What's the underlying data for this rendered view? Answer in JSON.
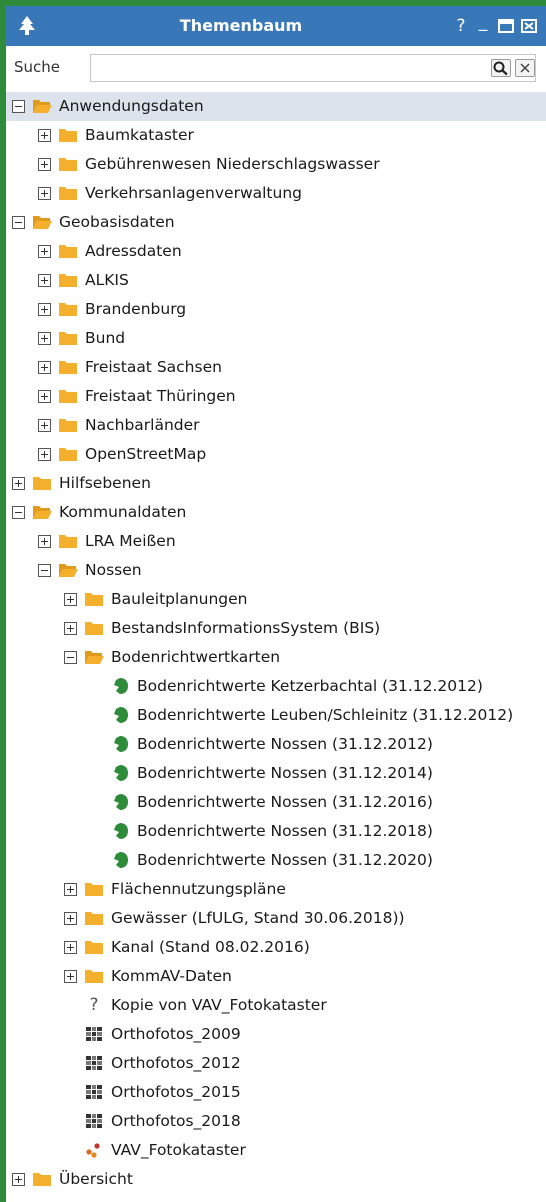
{
  "window": {
    "title": "Themenbaum",
    "icon": "tree-icon",
    "buttons": [
      {
        "name": "help-button",
        "glyph": "?"
      },
      {
        "name": "minimize-button",
        "glyph": "_"
      },
      {
        "name": "maximize-button",
        "glyph": "▭"
      },
      {
        "name": "close-button",
        "glyph": "✕"
      }
    ]
  },
  "search": {
    "label": "Suche",
    "value": "",
    "placeholder": ""
  },
  "colors": {
    "titlebar": "#3877b8",
    "folder": "#f4b02c",
    "layer_green": "#2e8b3a",
    "selected_row": "#dde3ed"
  },
  "tree": [
    {
      "label": "Anwendungsdaten",
      "level": 0,
      "expander": "minus",
      "icon": "folder-open-icon",
      "selected": true
    },
    {
      "label": "Baumkataster",
      "level": 1,
      "expander": "plus",
      "icon": "folder-icon"
    },
    {
      "label": "Gebührenwesen Niederschlagswasser",
      "level": 1,
      "expander": "plus",
      "icon": "folder-icon"
    },
    {
      "label": "Verkehrsanlagenverwaltung",
      "level": 1,
      "expander": "plus",
      "icon": "folder-icon"
    },
    {
      "label": "Geobasisdaten",
      "level": 0,
      "expander": "minus",
      "icon": "folder-open-icon"
    },
    {
      "label": "Adressdaten",
      "level": 1,
      "expander": "plus",
      "icon": "folder-icon"
    },
    {
      "label": "ALKIS",
      "level": 1,
      "expander": "plus",
      "icon": "folder-icon"
    },
    {
      "label": "Brandenburg",
      "level": 1,
      "expander": "plus",
      "icon": "folder-icon"
    },
    {
      "label": "Bund",
      "level": 1,
      "expander": "plus",
      "icon": "folder-icon"
    },
    {
      "label": "Freistaat Sachsen",
      "level": 1,
      "expander": "plus",
      "icon": "folder-icon"
    },
    {
      "label": "Freistaat Thüringen",
      "level": 1,
      "expander": "plus",
      "icon": "folder-icon"
    },
    {
      "label": "Nachbarländer",
      "level": 1,
      "expander": "plus",
      "icon": "folder-icon"
    },
    {
      "label": "OpenStreetMap",
      "level": 1,
      "expander": "plus",
      "icon": "folder-icon"
    },
    {
      "label": "Hilfsebenen",
      "level": 0,
      "expander": "plus",
      "icon": "folder-icon"
    },
    {
      "label": "Kommunaldaten",
      "level": 0,
      "expander": "minus",
      "icon": "folder-open-icon"
    },
    {
      "label": "LRA Meißen",
      "level": 1,
      "expander": "plus",
      "icon": "folder-icon"
    },
    {
      "label": "Nossen",
      "level": 1,
      "expander": "minus",
      "icon": "folder-open-icon"
    },
    {
      "label": "Bauleitplanungen",
      "level": 2,
      "expander": "plus",
      "icon": "folder-icon"
    },
    {
      "label": "BestandsInformationsSystem (BIS)",
      "level": 2,
      "expander": "plus",
      "icon": "folder-icon"
    },
    {
      "label": "Bodenrichtwertkarten",
      "level": 2,
      "expander": "minus",
      "icon": "folder-open-icon"
    },
    {
      "label": "Bodenrichtwerte Ketzerbachtal (31.12.2012)",
      "level": 3,
      "expander": "none",
      "icon": "layer-shape-icon"
    },
    {
      "label": "Bodenrichtwerte Leuben/Schleinitz (31.12.2012)",
      "level": 3,
      "expander": "none",
      "icon": "layer-shape-icon"
    },
    {
      "label": "Bodenrichtwerte Nossen (31.12.2012)",
      "level": 3,
      "expander": "none",
      "icon": "layer-shape-icon"
    },
    {
      "label": "Bodenrichtwerte Nossen (31.12.2014)",
      "level": 3,
      "expander": "none",
      "icon": "layer-shape-icon"
    },
    {
      "label": "Bodenrichtwerte Nossen (31.12.2016)",
      "level": 3,
      "expander": "none",
      "icon": "layer-shape-icon"
    },
    {
      "label": "Bodenrichtwerte Nossen (31.12.2018)",
      "level": 3,
      "expander": "none",
      "icon": "layer-shape-icon"
    },
    {
      "label": "Bodenrichtwerte Nossen (31.12.2020)",
      "level": 3,
      "expander": "none",
      "icon": "layer-shape-icon"
    },
    {
      "label": "Flächennutzungspläne",
      "level": 2,
      "expander": "plus",
      "icon": "folder-icon"
    },
    {
      "label": "Gewässer (LfULG, Stand 30.06.2018))",
      "level": 2,
      "expander": "plus",
      "icon": "folder-icon"
    },
    {
      "label": "Kanal (Stand 08.02.2016)",
      "level": 2,
      "expander": "plus",
      "icon": "folder-icon"
    },
    {
      "label": "KommAV-Daten",
      "level": 2,
      "expander": "plus",
      "icon": "folder-icon"
    },
    {
      "label": "Kopie von VAV_Fotokataster",
      "level": 2,
      "expander": "none",
      "icon": "unknown-layer-icon"
    },
    {
      "label": "Orthofotos_2009",
      "level": 2,
      "expander": "none",
      "icon": "raster-layer-icon"
    },
    {
      "label": "Orthofotos_2012",
      "level": 2,
      "expander": "none",
      "icon": "raster-layer-icon"
    },
    {
      "label": "Orthofotos_2015",
      "level": 2,
      "expander": "none",
      "icon": "raster-layer-icon"
    },
    {
      "label": "Orthofotos_2018",
      "level": 2,
      "expander": "none",
      "icon": "raster-layer-icon"
    },
    {
      "label": "VAV_Fotokataster",
      "level": 2,
      "expander": "none",
      "icon": "point-layer-icon"
    },
    {
      "label": "Übersicht",
      "level": 0,
      "expander": "plus",
      "icon": "folder-icon"
    }
  ]
}
